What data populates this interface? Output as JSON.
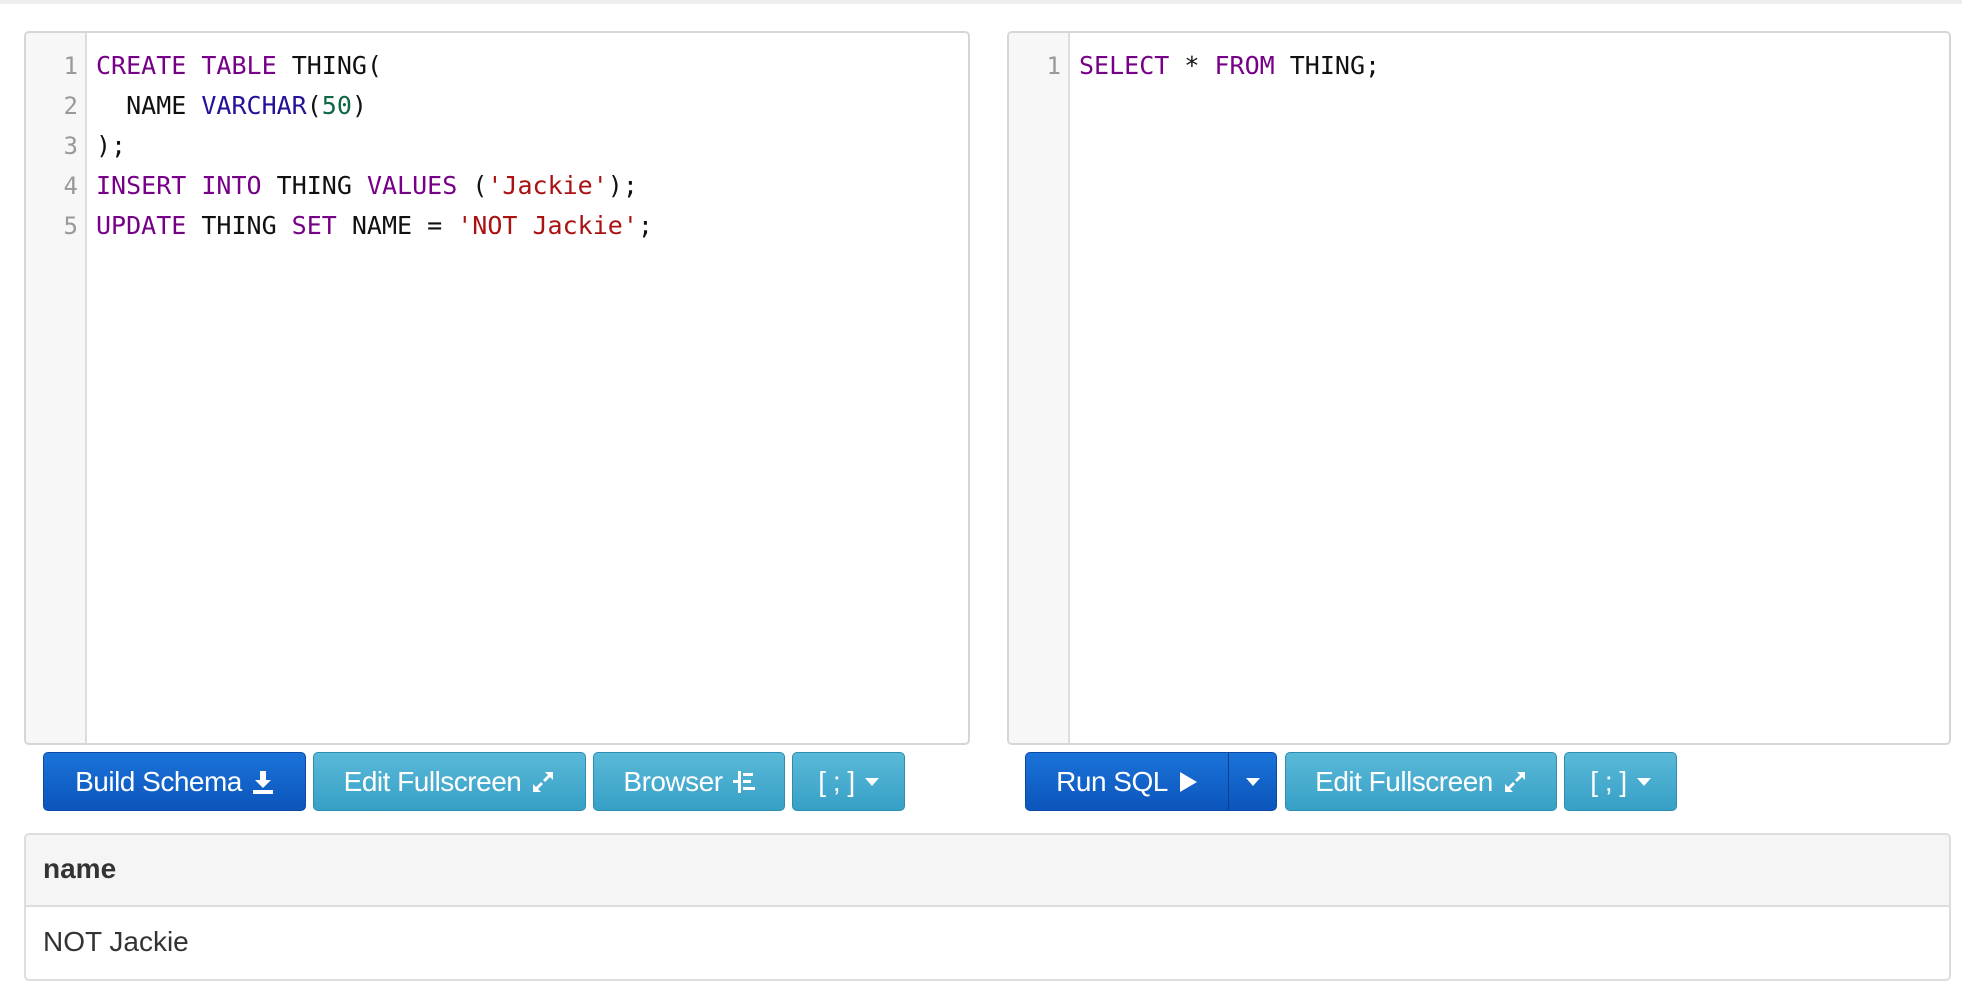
{
  "schema_editor": {
    "lines": [
      [
        {
          "t": "CREATE",
          "c": "k"
        },
        {
          "t": " "
        },
        {
          "t": "TABLE",
          "c": "k"
        },
        {
          "t": " THING("
        }
      ],
      [
        {
          "t": "  NAME "
        },
        {
          "t": "VARCHAR",
          "c": "b"
        },
        {
          "t": "("
        },
        {
          "t": "50",
          "c": "n"
        },
        {
          "t": ")"
        }
      ],
      [
        {
          "t": ");"
        }
      ],
      [
        {
          "t": "INSERT",
          "c": "k"
        },
        {
          "t": " "
        },
        {
          "t": "INTO",
          "c": "k"
        },
        {
          "t": " THING "
        },
        {
          "t": "VALUES",
          "c": "k"
        },
        {
          "t": " ("
        },
        {
          "t": "'Jackie'",
          "c": "s"
        },
        {
          "t": ");"
        }
      ],
      [
        {
          "t": "UPDATE",
          "c": "k"
        },
        {
          "t": " THING "
        },
        {
          "t": "SET",
          "c": "k"
        },
        {
          "t": " NAME = "
        },
        {
          "t": "'NOT Jackie'",
          "c": "s"
        },
        {
          "t": ";"
        }
      ]
    ]
  },
  "query_editor": {
    "lines": [
      [
        {
          "t": "SELECT",
          "c": "k"
        },
        {
          "t": " * "
        },
        {
          "t": "FROM",
          "c": "k"
        },
        {
          "t": " THING;"
        }
      ]
    ]
  },
  "schema_toolbar": {
    "build_schema": "Build Schema",
    "edit_fullscreen": "Edit Fullscreen",
    "browser": "Browser",
    "delimiter": "[ ; ]"
  },
  "query_toolbar": {
    "run_sql": "Run SQL",
    "edit_fullscreen": "Edit Fullscreen",
    "delimiter": "[ ; ]"
  },
  "results": {
    "columns": [
      "name"
    ],
    "rows": [
      [
        "NOT Jackie"
      ]
    ]
  },
  "colors": {
    "primary": "#0b55bb",
    "info": "#37a0c6",
    "keyword": "#770088",
    "builtin": "#221199",
    "number": "#116644",
    "string": "#aa1111"
  }
}
